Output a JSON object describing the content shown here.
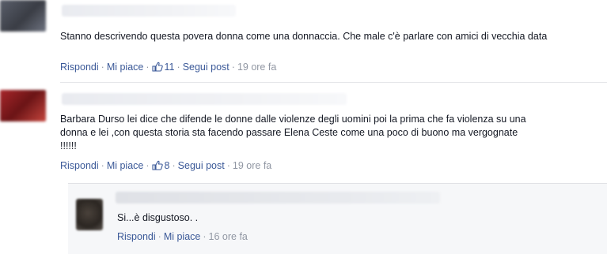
{
  "comments": [
    {
      "text": "Stanno descrivendo questa povera donna come una donnaccia. Che male c'è parlare con amici di vecchia data",
      "reply": "Rispondi",
      "like": "Mi piace",
      "likes": "11",
      "follow": "Segui post",
      "time": "19 ore fa"
    },
    {
      "text": "Barbara Durso lei dice che difende le donne dalle violenze degli uomini poi la prima che fa violenza su una donna e lei ,con questa storia sta facendo passare Elena Ceste come una poco di buono ma vergognate !!!!!!",
      "reply": "Rispondi",
      "like": "Mi piace",
      "likes": "8",
      "follow": "Segui post",
      "time": "19 ore fa"
    }
  ],
  "reply_comment": {
    "text": "Si...è disgustoso. .",
    "reply": "Rispondi",
    "like": "Mi piace",
    "time": "16 ore fa"
  },
  "colors": {
    "link": "#3b5998",
    "meta": "#9197a3",
    "text": "#141823"
  },
  "icons": [
    "thumbs-up-icon"
  ]
}
